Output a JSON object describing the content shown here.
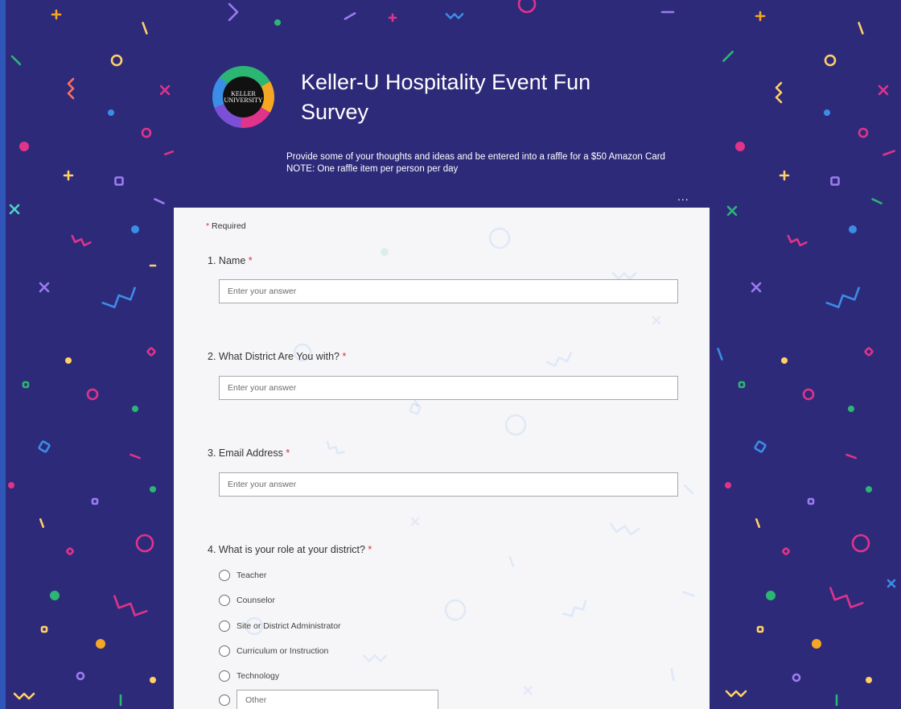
{
  "form": {
    "title": "Keller-U Hospitality Event Fun Survey",
    "description_lines": [
      "Provide some of your thoughts and ideas and be entered into a raffle for a $50 Amazon Card",
      "NOTE: One raffle item per person per day"
    ],
    "more_menu": "...",
    "logo_text": "KELLER UNIVERSITY"
  },
  "required_note": {
    "star": "*",
    "text": "Required"
  },
  "questions": [
    {
      "number": "1.",
      "label": "Name",
      "required": "*",
      "placeholder": "Enter your answer"
    },
    {
      "number": "2.",
      "label": "What District Are You with?",
      "required": "*",
      "placeholder": "Enter your answer"
    },
    {
      "number": "3.",
      "label": "Email Address",
      "required": "*",
      "placeholder": "Enter your answer"
    },
    {
      "number": "4.",
      "label": "What is your role at your district?",
      "required": "*",
      "options": [
        "Teacher",
        "Counselor",
        "Site or District Administrator",
        "Curriculum or Instruction",
        "Technology"
      ],
      "other_placeholder": "Other"
    }
  ],
  "colors": {
    "background": "#2e2a7a",
    "card": "#f6f6f9",
    "required_star": "#d13438",
    "confetti": [
      "#f5a623",
      "#e0338a",
      "#3a8ee6",
      "#2bb673",
      "#9b7cf0",
      "#ff6f61",
      "#4fd1c5",
      "#ffd166"
    ]
  }
}
